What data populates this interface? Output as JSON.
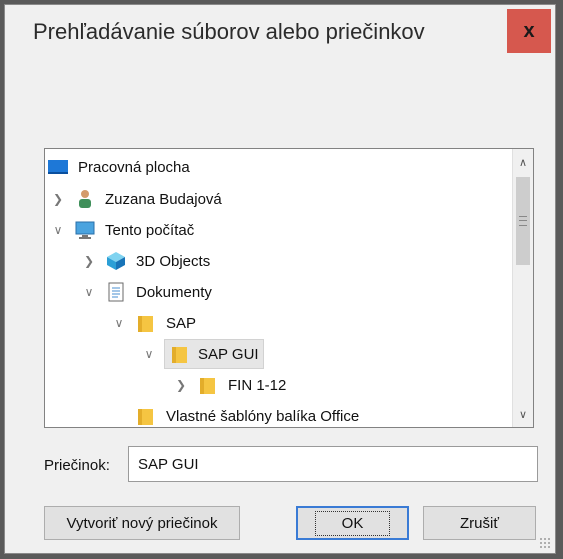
{
  "dialog": {
    "title": "Prehľadávanie súborov alebo priečinkov",
    "close_label": "x"
  },
  "tree": {
    "items": [
      {
        "label": "Pracovná plocha",
        "icon": "desktop-icon",
        "expander": "",
        "depth": 0
      },
      {
        "label": "Zuzana Budajová",
        "icon": "user-icon",
        "expander": ">",
        "depth": 1
      },
      {
        "label": "Tento počítač",
        "icon": "computer-icon",
        "expander": "v",
        "depth": 1
      },
      {
        "label": "3D Objects",
        "icon": "3d-objects-icon",
        "expander": ">",
        "depth": 2
      },
      {
        "label": "Dokumenty",
        "icon": "documents-icon",
        "expander": "v",
        "depth": 2
      },
      {
        "label": "SAP",
        "icon": "folder-icon",
        "expander": "v",
        "depth": 3
      },
      {
        "label": "SAP GUI",
        "icon": "folder-icon",
        "expander": "v",
        "depth": 4,
        "selected": true
      },
      {
        "label": "FIN 1-12",
        "icon": "folder-icon",
        "expander": ">",
        "depth": 5
      },
      {
        "label": "Vlastné šablóny balíka Office",
        "icon": "folder-icon",
        "expander": "",
        "depth": 3
      }
    ]
  },
  "folder": {
    "label": "Priečinok:",
    "value": "SAP GUI"
  },
  "buttons": {
    "new_folder": "Vytvoriť nový priečinok",
    "ok": "OK",
    "cancel": "Zrušiť"
  },
  "colors": {
    "close_button": "#d6584e",
    "folder_yellow": "#f5c542",
    "selection": "#e6e6e6",
    "ok_border": "#3a7bd5"
  }
}
